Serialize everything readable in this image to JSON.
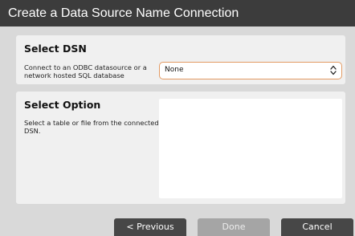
{
  "window": {
    "title": "Create a Data Source Name Connection"
  },
  "dsn_panel": {
    "heading": "Select DSN",
    "description": "Connect to an ODBC datasource or a network hosted SQL database",
    "select": {
      "selected_value": "None",
      "icon": "up-down-chevron-icon"
    }
  },
  "option_panel": {
    "heading": "Select Option",
    "description": "Select a table or file from the connected DSN.",
    "list_items": []
  },
  "buttons": {
    "previous_label": "< Previous",
    "done_label": "Done",
    "cancel_label": "Cancel"
  },
  "colors": {
    "titlebar_bg": "#3c3c3c",
    "dialog_bg": "#d9d9d9",
    "panel_bg": "#f0f0f0",
    "select_focus_border": "#e39a63",
    "button_bg": "#474747",
    "button_disabled_bg": "#a5a5a5"
  }
}
